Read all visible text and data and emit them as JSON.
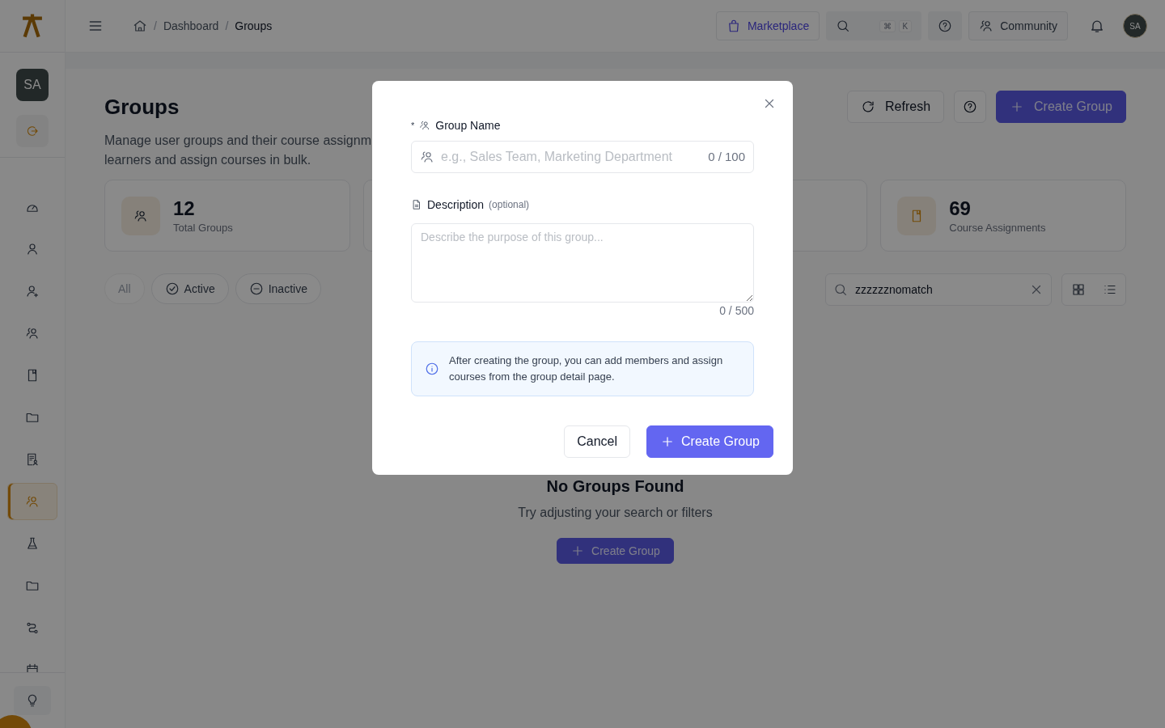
{
  "sidebar": {
    "avatar": "SA",
    "nav": [
      {
        "kind": "gauge",
        "selected": false
      },
      {
        "kind": "user",
        "selected": false
      },
      {
        "kind": "user-plus",
        "selected": false
      },
      {
        "kind": "users",
        "selected": false
      },
      {
        "kind": "book",
        "selected": false
      },
      {
        "kind": "folder",
        "selected": false
      },
      {
        "kind": "report",
        "selected": false
      },
      {
        "kind": "users",
        "selected": true
      },
      {
        "kind": "flask",
        "selected": false
      },
      {
        "kind": "folder",
        "selected": false
      },
      {
        "kind": "route",
        "selected": false
      },
      {
        "kind": "calendar",
        "selected": false
      }
    ]
  },
  "topbar": {
    "breadcrumb": [
      {
        "separator": "/",
        "label": "Dashboard",
        "current": false
      },
      {
        "separator": "/",
        "label": "Groups",
        "current": true
      }
    ],
    "marketplace": "Marketplace",
    "shortcut": [
      "⌘",
      "K"
    ],
    "community": "Community",
    "avatar": "SA"
  },
  "page": {
    "title": "Groups",
    "description_lines": [
      "Manage user groups and their course assignm",
      "learners and assign courses in bulk."
    ],
    "actions": {
      "refresh": "Refresh",
      "create": "Create Group"
    },
    "stats": [
      {
        "value": "12",
        "label": "Total Groups",
        "kind": "users"
      },
      {
        "value": "69",
        "label": "Course Assignments",
        "kind": "book"
      }
    ],
    "filters": [
      {
        "label": "All",
        "kind": "all",
        "selected": true
      },
      {
        "label": "Active",
        "kind": "active",
        "selected": false
      },
      {
        "label": "Inactive",
        "kind": "inactive",
        "selected": false
      }
    ],
    "search": {
      "value": "zzzzzznomatch"
    },
    "empty": {
      "title": "No Groups Found",
      "subtitle": "Try adjusting your search or filters",
      "button": "Create Group"
    }
  },
  "dialog": {
    "name_field": {
      "required_mark": "*",
      "label": "Group Name",
      "placeholder": "e.g., Sales Team, Marketing Department",
      "counter": "0 / 100"
    },
    "description_field": {
      "label": "Description",
      "hint": "(optional)",
      "placeholder": "Describe the purpose of this group...",
      "counter": "0 / 500"
    },
    "info": "After creating the group, you can add members and assign courses from the group detail page.",
    "buttons": {
      "cancel": "Cancel",
      "create": "Create Group"
    }
  }
}
